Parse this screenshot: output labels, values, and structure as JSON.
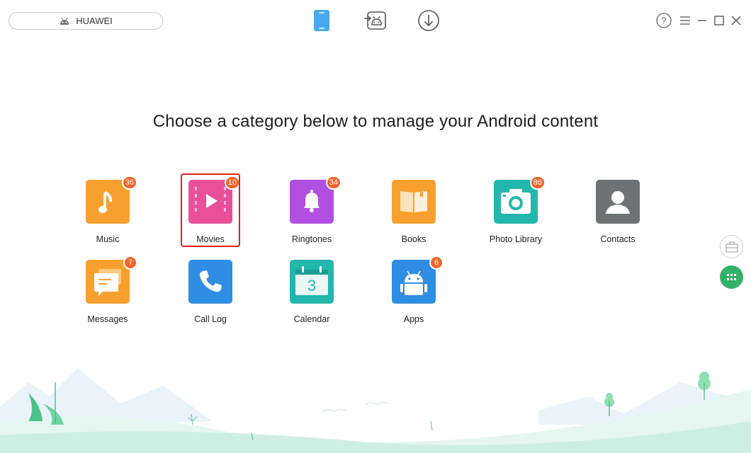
{
  "header": {
    "device_name": "HUAWEI",
    "device_icon": "android-icon",
    "nav_icons": [
      "phone-icon",
      "android-transfer-icon",
      "download-icon"
    ],
    "window_controls": [
      "help-icon",
      "menu-icon",
      "minimize-icon",
      "maximize-icon",
      "close-icon"
    ]
  },
  "main": {
    "headline": "Choose a category below to manage your Android content",
    "selected_category": "Movies",
    "categories": [
      {
        "label": "Music",
        "badge": "36",
        "icon": "music-note-icon",
        "color": "#f8a02e"
      },
      {
        "label": "Movies",
        "badge": "10",
        "icon": "play-icon",
        "color": "#ea4f9a"
      },
      {
        "label": "Ringtones",
        "badge": "34",
        "icon": "bell-icon",
        "color": "#b04fe0"
      },
      {
        "label": "Books",
        "badge": "",
        "icon": "book-icon",
        "color": "#f8a02e"
      },
      {
        "label": "Photo Library",
        "badge": "86",
        "icon": "camera-icon",
        "color": "#22b6ad"
      },
      {
        "label": "Contacts",
        "badge": "",
        "icon": "contact-person-icon",
        "color": "#6e7275"
      },
      {
        "label": "Messages",
        "badge": "7",
        "icon": "message-icon",
        "color": "#f8a02e"
      },
      {
        "label": "Call Log",
        "badge": "",
        "icon": "phone-handset-icon",
        "color": "#2f8de4"
      },
      {
        "label": "Calendar",
        "badge": "",
        "icon": "calendar-icon",
        "color": "#22b6ad",
        "calendar_day": "3"
      },
      {
        "label": "Apps",
        "badge": "6",
        "icon": "android-app-icon",
        "color": "#2f8de4"
      }
    ]
  },
  "side_buttons": [
    "toolkit-icon",
    "grid-icon"
  ],
  "accent_colors": {
    "badge": "#f0652b",
    "selection": "#e02020",
    "active_side": "#33b06a",
    "nav_active": "#4aa8f0"
  }
}
